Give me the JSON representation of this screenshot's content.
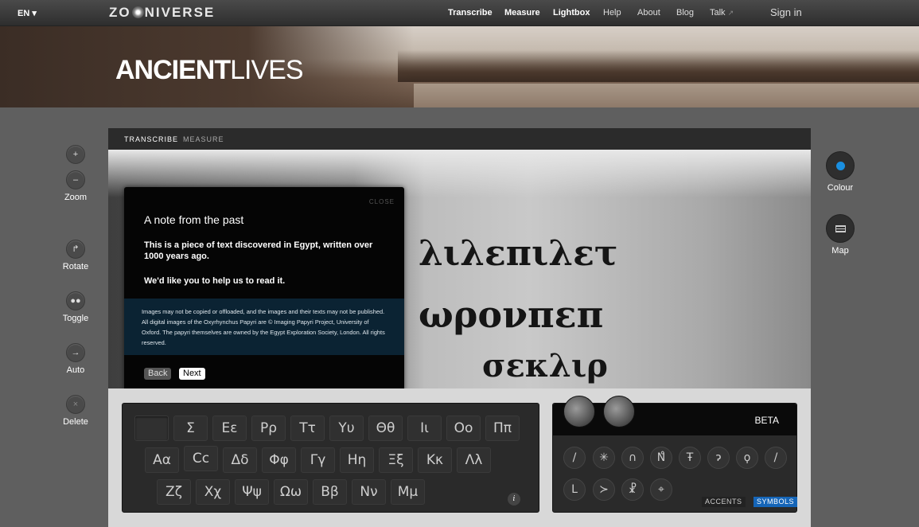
{
  "topbar": {
    "lang": "EN",
    "logo": "ZO NIVERSE",
    "nav": [
      "Transcribe",
      "Measure",
      "Lightbox",
      "Help",
      "About",
      "Blog",
      "Talk"
    ],
    "signin": "Sign in"
  },
  "banner": {
    "title_bold": "ANCIENT",
    "title_light": "LIVES"
  },
  "left_tools": {
    "zoom": "Zoom",
    "rotate": "Rotate",
    "toggle": "Toggle",
    "auto": "Auto",
    "delete": "Delete"
  },
  "right_tools": {
    "colour": "Colour",
    "map": "Map"
  },
  "tabs": {
    "transcribe": "TRANSCRIBE",
    "measure": "MEASURE"
  },
  "note": {
    "close": "CLOSE",
    "title": "A note from the past",
    "text1": "This is a piece of text discovered in Egypt, written over 1000 years ago.",
    "text2": "We'd like you to help us to read it.",
    "legal": "Images may not be copied or offloaded, and the images and their texts may not be published. All digital images of the Oxyrhynchus Papyri are © Imaging Papyri Project, University of Oxford. The papyri themselves are owned by the Egypt Exploration Society, London. All rights reserved.",
    "back": "Back",
    "next": "Next"
  },
  "papyrus_text": {
    "line1": "λιλεπιλετ",
    "line2": "ωρονπεπ",
    "line3": "σεκλιρ"
  },
  "keyboard": {
    "row1": [
      "",
      "Σ",
      "Εε",
      "Ρρ",
      "Ττ",
      "Υυ",
      "Θθ",
      "Ιι",
      "Οο",
      "Ππ"
    ],
    "row2": [
      "Αα",
      "Cc",
      "Δδ",
      "Φφ",
      "Γγ",
      "Ηη",
      "Ξξ",
      "Κκ",
      "Λλ"
    ],
    "row3": [
      "Ζζ",
      "Χχ",
      "Ψψ",
      "Ωω",
      "Ββ",
      "Νν",
      "Μμ"
    ],
    "info": "i"
  },
  "symbols": {
    "beta": "BETA",
    "row1": [
      "/",
      "✳",
      "∩",
      "Ν̊",
      "Ŧ",
      "ɂ",
      "ϙ",
      "/"
    ],
    "row2": [
      "L",
      "≻",
      "☧",
      "⌖"
    ],
    "accents": "ACCENTS",
    "symbols_tab": "SYMBOLS"
  },
  "colors": {
    "accent_blue": "#1a8fe0",
    "symbols_tab": "#1565b8"
  }
}
